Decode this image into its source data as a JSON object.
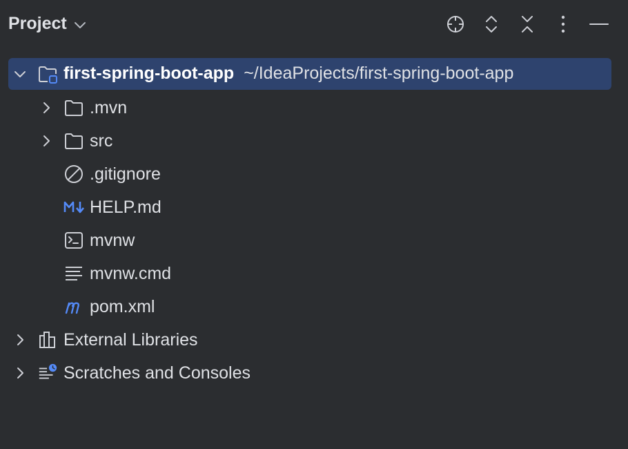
{
  "header": {
    "title": "Project",
    "tools": [
      {
        "name": "locate-icon"
      },
      {
        "name": "expand-collapse-icon"
      },
      {
        "name": "collapse-all-icon"
      },
      {
        "name": "more-icon"
      },
      {
        "name": "minimize-icon"
      }
    ]
  },
  "tree": {
    "root": {
      "name": "first-spring-boot-app",
      "path": "~/IdeaProjects/first-spring-boot-app"
    },
    "items": [
      {
        "label": ".mvn",
        "icon": "folder-icon"
      },
      {
        "label": "src",
        "icon": "folder-icon"
      },
      {
        "label": ".gitignore",
        "icon": "ignore-file-icon"
      },
      {
        "label": "HELP.md",
        "icon": "markdown-icon"
      },
      {
        "label": "mvnw",
        "icon": "terminal-file-icon"
      },
      {
        "label": "mvnw.cmd",
        "icon": "text-file-icon"
      },
      {
        "label": "pom.xml",
        "icon": "maven-icon"
      }
    ],
    "external_libraries": "External Libraries",
    "scratches": "Scratches and Consoles"
  },
  "colors": {
    "background": "#2b2d30",
    "selection": "#2e436e",
    "accent": "#548af7"
  }
}
